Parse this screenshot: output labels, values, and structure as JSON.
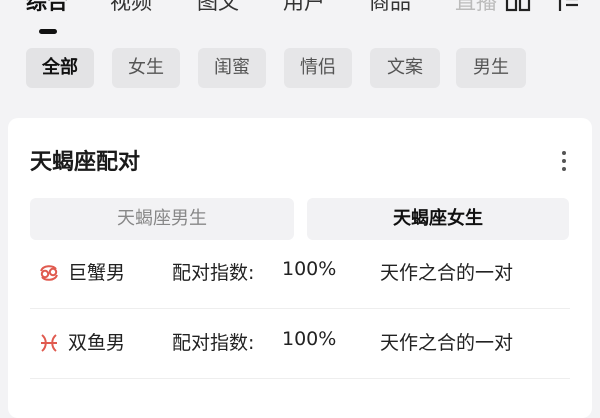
{
  "top_tabs": {
    "items": [
      {
        "label": "综合",
        "active": true
      },
      {
        "label": "视频",
        "active": false
      },
      {
        "label": "图文",
        "active": false
      },
      {
        "label": "用户",
        "active": false
      },
      {
        "label": "商品",
        "active": false
      },
      {
        "label": "直播",
        "active": false
      }
    ],
    "icons": [
      "layout-icon",
      "filter-icon"
    ]
  },
  "filter_chips": [
    {
      "label": "全部",
      "active": true
    },
    {
      "label": "女生",
      "active": false
    },
    {
      "label": "闺蜜",
      "active": false
    },
    {
      "label": "情侣",
      "active": false
    },
    {
      "label": "文案",
      "active": false
    },
    {
      "label": "男生",
      "active": false
    }
  ],
  "card": {
    "title": "天蝎座配对",
    "more_icon": "more-vertical-icon",
    "segments": {
      "left": "天蝎座男生",
      "right": "天蝎座女生",
      "selected": "right"
    },
    "rows": [
      {
        "sign_icon": "cancer-icon",
        "name": "巨蟹男",
        "score_label": "配对指数:",
        "score_value": "100%",
        "desc": "天作之合的一对"
      },
      {
        "sign_icon": "pisces-icon",
        "name": "双鱼男",
        "score_label": "配对指数:",
        "score_value": "100%",
        "desc": "天作之合的一对"
      }
    ]
  },
  "colors": {
    "page_bg": "#f3f3f5",
    "card_bg": "#ffffff",
    "chip_bg": "#e6e6e8",
    "sign_red": "#e05a4f"
  }
}
